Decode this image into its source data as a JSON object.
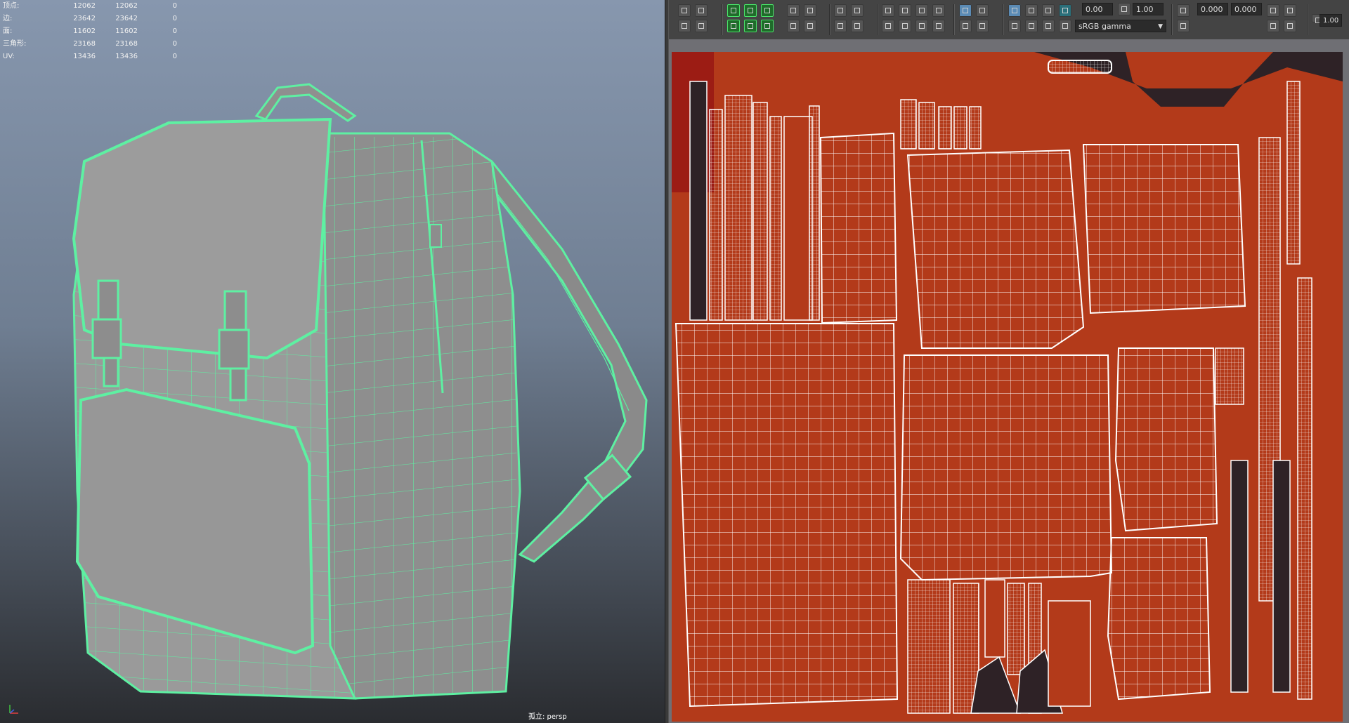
{
  "viewport": {
    "camera_label": "孤立: persp",
    "hud": [
      {
        "label": "顶点:",
        "v1": "12062",
        "v2": "12062",
        "v3": "0"
      },
      {
        "label": "边:",
        "v1": "23642",
        "v2": "23642",
        "v3": "0"
      },
      {
        "label": "面:",
        "v1": "11602",
        "v2": "11602",
        "v3": "0"
      },
      {
        "label": "三角形:",
        "v1": "23168",
        "v2": "23168",
        "v3": "0"
      },
      {
        "label": "UV:",
        "v1": "13436",
        "v2": "13436",
        "v3": "0"
      }
    ],
    "wireframe_color": "#5ef0a2",
    "mesh_color": "#9a9a9a"
  },
  "uv_editor": {
    "toolbar": {
      "exposure_value": "0.00",
      "gamma_value": "1.00",
      "colorspace": "sRGB gamma",
      "uv_u": "0.000",
      "uv_v": "0.000",
      "zoom": "1.00"
    },
    "texture_color": "#b33a1a",
    "dark_color": "#2e2226",
    "wire_color": "#ffffff",
    "background_color": "#6f6f74"
  },
  "icons": [
    "select-icon",
    "move-icon",
    "rotate-icon",
    "scale-icon",
    "flip-icon",
    "align-icon",
    "grid-icon",
    "checker-icon",
    "snapshot-icon",
    "exposure-icon",
    "gamma-icon",
    "axis-gizmo-icon",
    "zoom-up-icon",
    "zoom-down-icon"
  ]
}
